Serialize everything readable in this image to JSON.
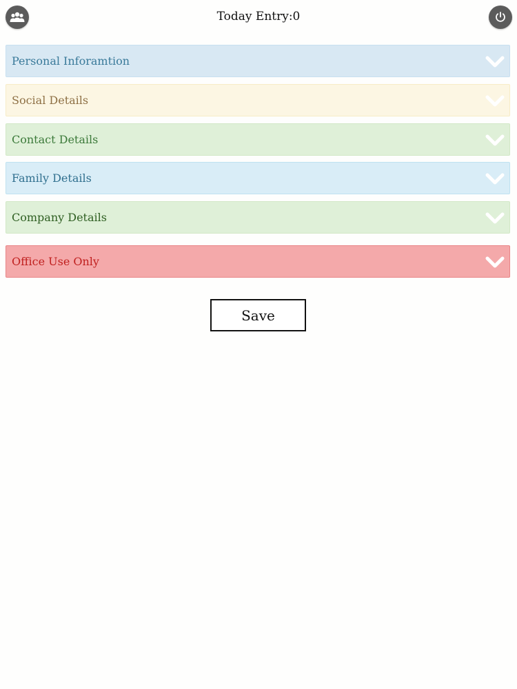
{
  "header": {
    "title": "Today Entry:0",
    "left_icon": "group-icon",
    "right_icon": "power-icon"
  },
  "panels": [
    {
      "label": "Personal Inforamtion",
      "bg": "#d8e8f3",
      "border": "#c7dff0",
      "text": "#3a7a9a"
    },
    {
      "label": "Social Details",
      "bg": "#fcf6e3",
      "border": "#f7ecc7",
      "text": "#8e7045"
    },
    {
      "label": "Contact Details",
      "bg": "#dff0d8",
      "border": "#d2e8c6",
      "text": "#3c7a3a"
    },
    {
      "label": "Family Details",
      "bg": "#d9edf7",
      "border": "#bfe2f0",
      "text": "#31708f"
    },
    {
      "label": "Company Details",
      "bg": "#dff0d8",
      "border": "#d2e8c6",
      "text": "#2f5f22"
    },
    {
      "label": "Office Use Only",
      "bg": "#f4a9aa",
      "border": "#e88587",
      "text": "#c0201f"
    }
  ],
  "save_label": "Save"
}
